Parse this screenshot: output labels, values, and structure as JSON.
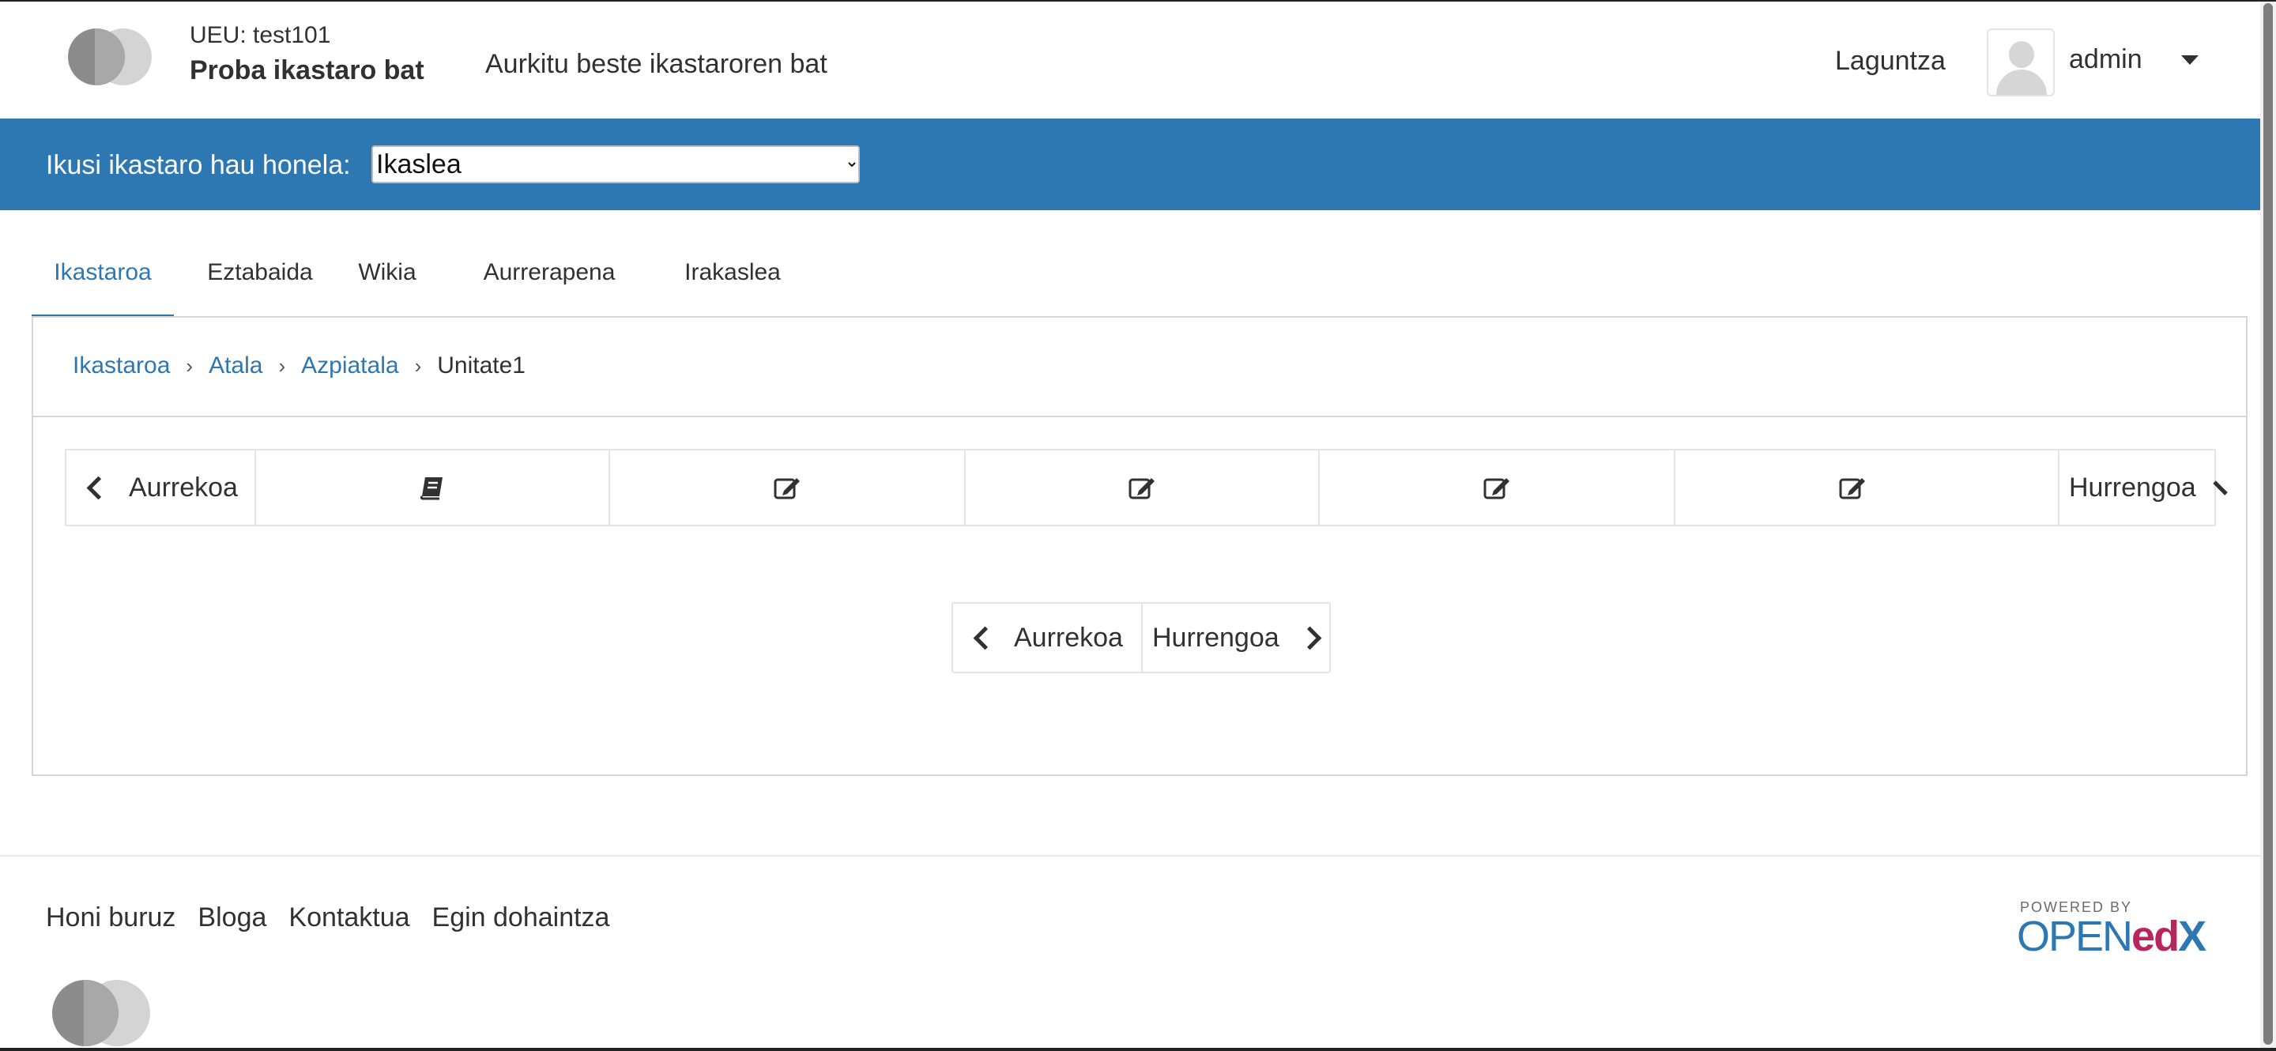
{
  "header": {
    "org_line": "UEU: test101",
    "course_title": "Proba ikastaro bat",
    "find_course": "Aurkitu beste ikastaroren bat",
    "help": "Laguntza",
    "username": "admin"
  },
  "preview": {
    "label": "Ikusi ikastaro hau honela:",
    "selected": "Ikaslea"
  },
  "tabs": [
    {
      "label": "Ikastaroa",
      "active": true
    },
    {
      "label": "Eztabaida"
    },
    {
      "label": "Wikia"
    },
    {
      "label": "Aurrerapena"
    },
    {
      "label": "Irakaslea"
    }
  ],
  "breadcrumb": [
    "Ikastaroa",
    "Atala",
    "Azpiatala",
    "Unitate1"
  ],
  "sequence": {
    "prev": "Aurrekoa",
    "next": "Hurrengoa",
    "items": [
      "book-icon",
      "edit-icon",
      "edit-icon",
      "edit-icon",
      "edit-icon"
    ]
  },
  "bottom_nav": {
    "prev": "Aurrekoa",
    "next": "Hurrengoa"
  },
  "footer": {
    "links": [
      "Honi buruz",
      "Bloga",
      "Kontaktua",
      "Egin dohaintza"
    ],
    "powered_by": "POWERED BY",
    "brand_open": "OPEN",
    "brand_ed": "ed",
    "brand_x": "X"
  }
}
